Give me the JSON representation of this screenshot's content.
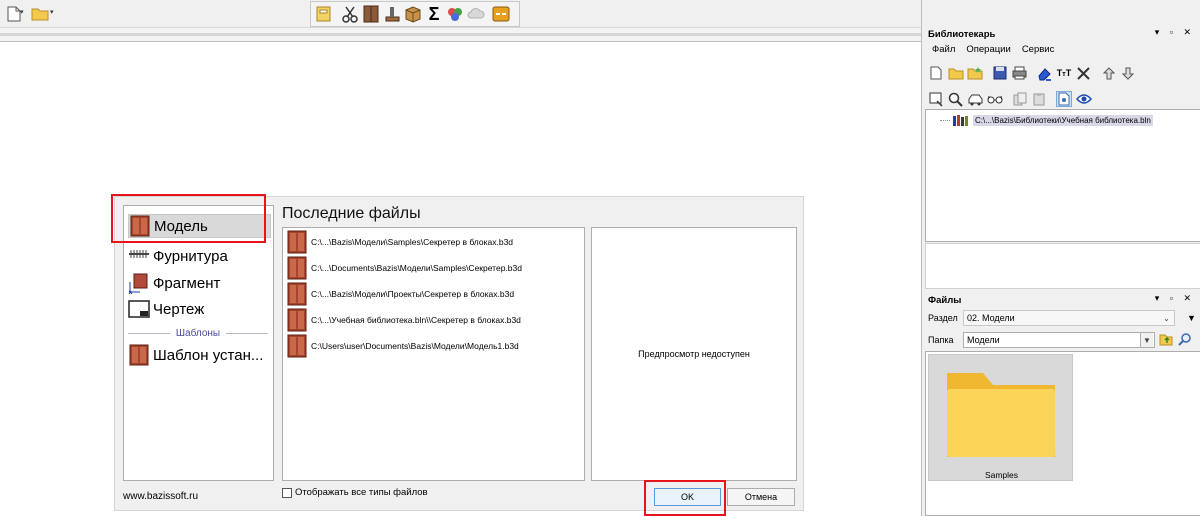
{
  "dialog": {
    "categories": [
      {
        "label": "Модель"
      },
      {
        "label": "Фурнитура"
      },
      {
        "label": "Фрагмент"
      },
      {
        "label": "Чертеж"
      }
    ],
    "templates_header": "Шаблоны",
    "template_item": "Шаблон устан...",
    "recent_title": "Последние файлы",
    "recent_files": [
      "C:\\...\\Bazis\\Модели\\Samples\\Секретер в блоках.b3d",
      "C:\\...\\Documents\\Bazis\\Модели\\Samples\\Секретер.b3d",
      "C:\\...\\Bazis\\Модели\\Проекты\\Секретер в блоках.b3d",
      "C:\\...\\Учебная библиотека.bln\\\\Секретер в блоках.b3d",
      "C:\\Users\\user\\Documents\\Bazis\\Модели\\Модель1.b3d"
    ],
    "preview_text": "Предпросмотр недоступен",
    "website": "www.bazissoft.ru",
    "show_all_label": "Отображать все типы файлов",
    "show_all_checked": false,
    "ok_label": "OK",
    "cancel_label": "Отмена"
  },
  "librarian": {
    "title": "Библиотекарь",
    "header_buttons": "▾ ▫ ✕",
    "menu": [
      "Файл",
      "Операции",
      "Сервис"
    ],
    "tree_path": "C:\\...\\Bazis\\Библиотеки\\Учебная библиотека.bln"
  },
  "files": {
    "title": "Файлы",
    "header_buttons": "▾ ▫ ✕",
    "section_label": "Раздел",
    "section_value": "02. Модели",
    "folder_label": "Папка",
    "folder_value": "Модели",
    "folder_items": [
      "Samples"
    ]
  },
  "colors": {
    "highlight_red": "#e8141b",
    "folder_yellow": "#fcd558",
    "selection_gray": "#d9d9d9"
  }
}
